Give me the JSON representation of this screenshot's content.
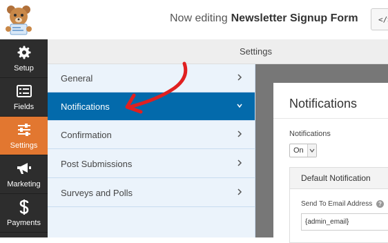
{
  "header": {
    "editing_prefix": "Now editing",
    "form_name": "Newsletter Signup Form",
    "code_button_label": "</>"
  },
  "rail": {
    "items": [
      {
        "label": "Setup",
        "icon": "gear-icon"
      },
      {
        "label": "Fields",
        "icon": "fields-list-icon"
      },
      {
        "label": "Settings",
        "icon": "sliders-icon",
        "active": true
      },
      {
        "label": "Marketing",
        "icon": "megaphone-icon"
      },
      {
        "label": "Payments",
        "icon": "dollar-icon"
      }
    ]
  },
  "settings_header": {
    "title": "Settings"
  },
  "nav": {
    "items": [
      {
        "label": "General",
        "icon": "chevron-right-icon"
      },
      {
        "label": "Notifications",
        "icon": "chevron-down-icon",
        "active": true
      },
      {
        "label": "Confirmation",
        "icon": "chevron-right-icon"
      },
      {
        "label": "Post Submissions",
        "icon": "chevron-right-icon"
      },
      {
        "label": "Surveys and Polls",
        "icon": "chevron-right-icon"
      }
    ]
  },
  "panel": {
    "title": "Notifications",
    "notifications_label": "Notifications",
    "notifications_value": "On",
    "default_notification_title": "Default Notification",
    "send_to_label": "Send To Email Address",
    "send_to_value": "{admin_email}"
  },
  "colors": {
    "rail_bg": "#2d2d2d",
    "rail_active": "#e27730",
    "nav_active": "#036aab",
    "nav_bg": "#ebf3fb",
    "annotation_arrow": "#e02020"
  }
}
